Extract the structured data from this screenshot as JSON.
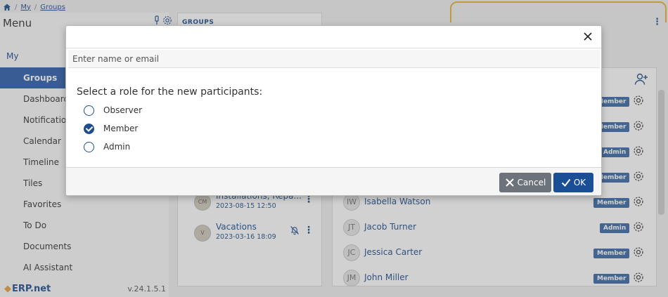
{
  "breadcrumb": {
    "items": [
      "My",
      "Groups"
    ]
  },
  "sidebar": {
    "title": "Menu",
    "section": "My",
    "items": [
      {
        "label": "Groups",
        "active": true
      },
      {
        "label": "Dashboard"
      },
      {
        "label": "Notifications"
      },
      {
        "label": "Calendar"
      },
      {
        "label": "Timeline"
      },
      {
        "label": "Tiles"
      },
      {
        "label": "Favorites"
      },
      {
        "label": "To Do"
      },
      {
        "label": "Documents"
      },
      {
        "label": "AI Assistant"
      }
    ],
    "logo": "ERP.net",
    "version": "v.24.1.5.1"
  },
  "groups_panel": {
    "header": "GROUPS",
    "items": [
      {
        "initials": "CM",
        "name": "Installations, Repa...",
        "date": "2023-08-15 12:50"
      },
      {
        "initials": "V",
        "name": "Vacations",
        "date": "2023-03-16 18:09"
      }
    ]
  },
  "members": [
    {
      "initials": "",
      "name": "",
      "role": "Member"
    },
    {
      "initials": "",
      "name": "",
      "role": "Member"
    },
    {
      "initials": "",
      "name": "",
      "role": "Admin"
    },
    {
      "initials": "",
      "name": "",
      "role": "Member"
    },
    {
      "initials": "IW",
      "name": "Isabella Watson",
      "role": "Member"
    },
    {
      "initials": "JT",
      "name": "Jacob Turner",
      "role": "Admin"
    },
    {
      "initials": "JC",
      "name": "Jessica Carter",
      "role": "Member"
    },
    {
      "initials": "JM",
      "name": "John Miller",
      "role": "Member"
    }
  ],
  "dialog": {
    "input_placeholder": "Enter name or email",
    "input_value": "",
    "prompt": "Select a role for the new participants:",
    "roles": [
      {
        "label": "Observer",
        "selected": false
      },
      {
        "label": "Member",
        "selected": true
      },
      {
        "label": "Admin",
        "selected": false
      }
    ],
    "cancel_label": "Cancel",
    "ok_label": "OK"
  },
  "colors": {
    "accent": "#1f4e8c",
    "active_menu": "#2b5eab",
    "cancel_button": "#6c737a",
    "ok_button": "#1b4f95",
    "highlight_frame": "#e8b23a"
  },
  "icons": [
    "home-icon",
    "settings-icon",
    "close-icon",
    "check-icon",
    "add-person-icon",
    "mute-icon",
    "kebab-icon"
  ]
}
